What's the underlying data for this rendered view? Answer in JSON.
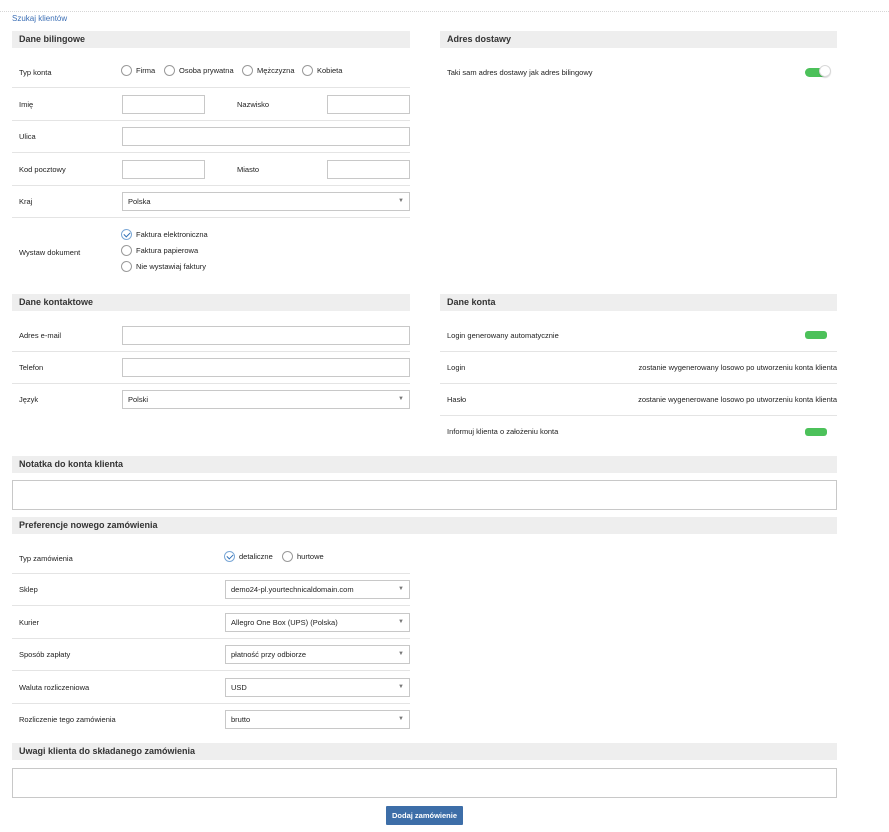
{
  "search_link": "Szukaj klientów",
  "billing": {
    "title": "Dane bilingowe",
    "account_type_label": "Typ konta",
    "account_types": [
      {
        "label": "Firma",
        "checked": false
      },
      {
        "label": "Osoba prywatna",
        "checked": false
      },
      {
        "label": "Mężczyzna",
        "checked": false
      },
      {
        "label": "Kobieta",
        "checked": false
      }
    ],
    "first_name_label": "Imię",
    "first_name_value": "",
    "last_name_label": "Nazwisko",
    "last_name_value": "",
    "street_label": "Ulica",
    "street_value": "",
    "postal_code_label": "Kod pocztowy",
    "postal_code_value": "",
    "city_label": "Miasto",
    "city_value": "",
    "country_label": "Kraj",
    "country_value": "Polska",
    "document_label": "Wystaw dokument",
    "document_options": [
      {
        "label": "Faktura elektroniczna",
        "checked": true
      },
      {
        "label": "Faktura papierowa",
        "checked": false
      },
      {
        "label": "Nie wystawiaj faktury",
        "checked": false
      }
    ]
  },
  "delivery": {
    "title": "Adres dostawy",
    "same_address_label": "Taki sam adres dostawy jak adres bilingowy",
    "same_address_on": true
  },
  "contact": {
    "title": "Dane kontaktowe",
    "email_label": "Adres e-mail",
    "email_value": "",
    "phone_label": "Telefon",
    "phone_value": "",
    "language_label": "Język",
    "language_value": "Polski"
  },
  "account": {
    "title": "Dane konta",
    "auto_login_label": "Login generowany automatycznie",
    "auto_login_on": true,
    "login_label": "Login",
    "login_note": "zostanie wygenerowany losowo po utworzeniu konta klienta",
    "password_label": "Hasło",
    "password_note": "zostanie wygenerowane losowo po utworzeniu konta klienta",
    "notify_label": "Informuj klienta o założeniu konta",
    "notify_on": true
  },
  "note": {
    "title": "Notatka do konta klienta",
    "value": ""
  },
  "order_prefs": {
    "title": "Preferencje nowego zamówienia",
    "order_type_label": "Typ zamówienia",
    "order_types": [
      {
        "label": "detaliczne",
        "checked": true
      },
      {
        "label": "hurtowe",
        "checked": false
      }
    ],
    "shop_label": "Sklep",
    "shop_value": "demo24-pl.yourtechnicaldomain.com",
    "courier_label": "Kurier",
    "courier_value": "Allegro One Box (UPS) (Polska)",
    "payment_label": "Sposób zapłaty",
    "payment_value": "płatność przy odbiorze",
    "currency_label": "Waluta rozliczeniowa",
    "currency_value": "USD",
    "settlement_label": "Rozliczenie tego zamówienia",
    "settlement_value": "brutto"
  },
  "remarks": {
    "title": "Uwagi klienta do składanego zamówienia",
    "value": ""
  },
  "submit_label": "Dodaj zamówienie",
  "colors": {
    "accent": "#3d6ea8",
    "toggle_on": "#4cc15a",
    "header_bg": "#eeeeee"
  }
}
